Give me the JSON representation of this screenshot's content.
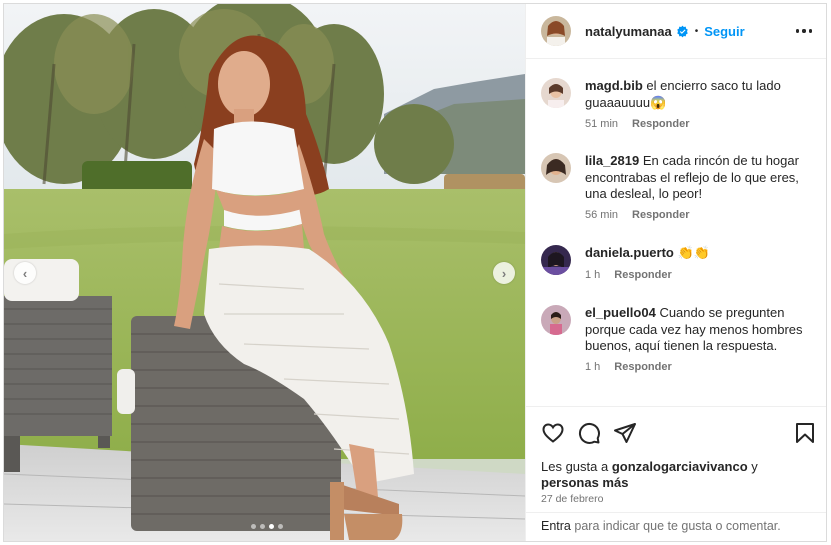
{
  "post": {
    "author": "natalyumanaa",
    "follow_label": "Seguir",
    "separator": "•",
    "carousel": {
      "slide_count": 4,
      "active_index": 2
    }
  },
  "comments": [
    {
      "username": "magd.bib",
      "text": "el encierro saco tu lado guaaauuuu😱",
      "time": "51 min",
      "reply": "Responder"
    },
    {
      "username": "lila_2819",
      "text": "En cada rincón de tu hogar encontrabas el reflejo de lo que eres, una desleal, lo peor!",
      "time": "56 min",
      "reply": "Responder"
    },
    {
      "username": "daniela.puerto",
      "text": "👏👏",
      "time": "1 h",
      "reply": "Responder"
    },
    {
      "username": "el_puello04",
      "text": "Cuando se pregunten porque cada vez hay menos hombres buenos, aquí tienen la respuesta.",
      "time": "1 h",
      "reply": "Responder"
    }
  ],
  "likes": {
    "prefix": "Les gusta a",
    "user": "gonzalogarciavivanco",
    "suffix": "y",
    "others": "personas más"
  },
  "date": "27 de febrero",
  "add_comment": {
    "entra": "Entra",
    "rest": "para indicar que te gusta o comentar."
  },
  "colors": {
    "accent": "#0095f6",
    "text": "#262626",
    "muted": "#737373",
    "border": "#dbdbdb"
  },
  "icons": {
    "like": "heart-icon",
    "comment": "comment-icon",
    "share": "share-icon",
    "save": "bookmark-icon",
    "verified": "verified-badge-icon",
    "more": "more-options-icon",
    "prev": "chevron-left-icon",
    "next": "chevron-right-icon"
  }
}
